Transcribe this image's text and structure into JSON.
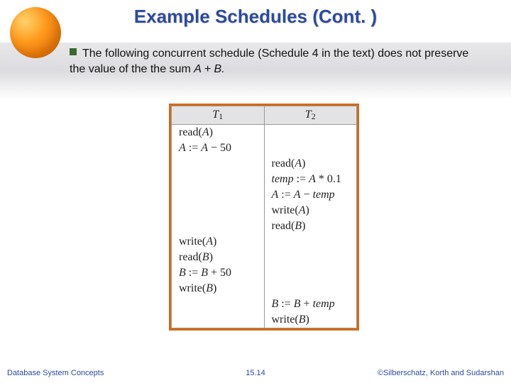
{
  "title": "Example Schedules (Cont. )",
  "bullet": {
    "pre": "The following concurrent schedule (Schedule 4 in the text) does not preserve the value of the the sum ",
    "expr": "A + B.",
    "full_text": "The following concurrent schedule (Schedule 4 in the text) does not preserve the value of the the sum A + B."
  },
  "table": {
    "headers": {
      "t1": "T",
      "t1sub": "1",
      "t2": "T",
      "t2sub": "2"
    },
    "rows": [
      {
        "t1": "read(A)",
        "t2": ""
      },
      {
        "t1": "A := A − 50",
        "t2": ""
      },
      {
        "t1": "",
        "t2": "read(A)"
      },
      {
        "t1": "",
        "t2": "temp := A * 0.1"
      },
      {
        "t1": "",
        "t2": "A := A − temp"
      },
      {
        "t1": "",
        "t2": "write(A)"
      },
      {
        "t1": "",
        "t2": "read(B)"
      },
      {
        "t1": "write(A)",
        "t2": ""
      },
      {
        "t1": "read(B)",
        "t2": ""
      },
      {
        "t1": "B := B + 50",
        "t2": ""
      },
      {
        "t1": "write(B)",
        "t2": ""
      },
      {
        "t1": "",
        "t2": "B := B + temp"
      },
      {
        "t1": "",
        "t2": "write(B)"
      }
    ]
  },
  "footer": {
    "left": "Database System Concepts",
    "center": "15.14",
    "right": "©Silberschatz, Korth and Sudarshan"
  }
}
